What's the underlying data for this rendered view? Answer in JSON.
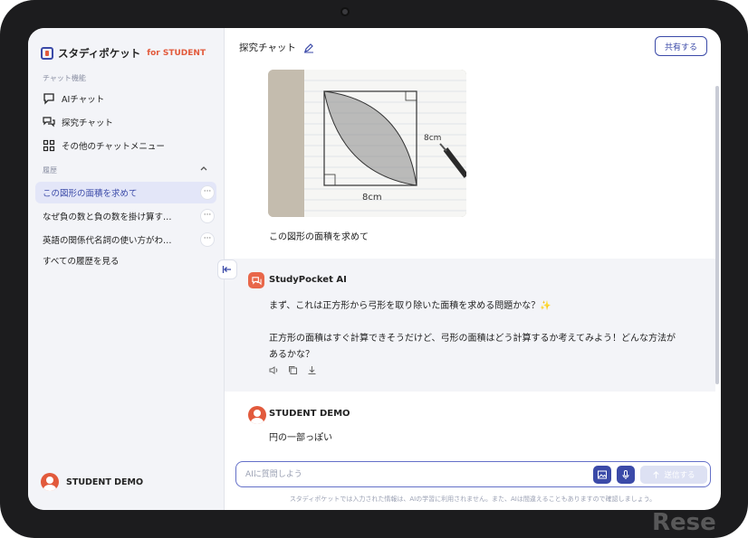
{
  "app": {
    "brand": "スタディポケット",
    "brand_sub": "for STUDENT"
  },
  "sidebar": {
    "section_chat": "チャット機能",
    "items": [
      {
        "label": "AIチャット",
        "icon": "chat-bubble-icon"
      },
      {
        "label": "探究チャット",
        "icon": "explore-chat-icon"
      },
      {
        "label": "その他のチャットメニュー",
        "icon": "grid-menu-icon"
      }
    ],
    "section_history": "履歴",
    "history": [
      {
        "label": "この図形の面積を求めて",
        "active": true
      },
      {
        "label": "なぜ負の数と負の数を掛け算す…",
        "active": false
      },
      {
        "label": "英語の関係代名詞の使い方がわ…",
        "active": false
      }
    ],
    "all_history": "すべての履歴を見る",
    "user_name": "STUDENT DEMO"
  },
  "header": {
    "title": "探究チャット",
    "share_label": "共有する"
  },
  "photo": {
    "label_side": "8cm",
    "label_bottom": "8cm"
  },
  "messages": {
    "user_1": "この図形の面積を求めて",
    "ai_name": "StudyPocket AI",
    "ai_line_1": "まず、これは正方形から弓形を取り除いた面積を求める問題かな？✨",
    "ai_line_2": "正方形の面積はすぐ計算できそうだけど、弓形の面積はどう計算するか考えてみよう！どんな方法が",
    "ai_line_3": "あるかな？",
    "user_2_name": "STUDENT DEMO",
    "user_2": "円の一部っぽい"
  },
  "composer": {
    "placeholder": "AIに質問しよう",
    "send_label": "送信する",
    "disclaimer": "スタディポケットでは入力された情報は、AIの学習に利用されません。また、AIは間違えることもありますので確認しましょう。"
  },
  "watermark": "Rese",
  "colors": {
    "accent": "#3b4aa8",
    "brand_orange": "#e25a3c",
    "sidebar_bg": "#f3f4f8"
  }
}
